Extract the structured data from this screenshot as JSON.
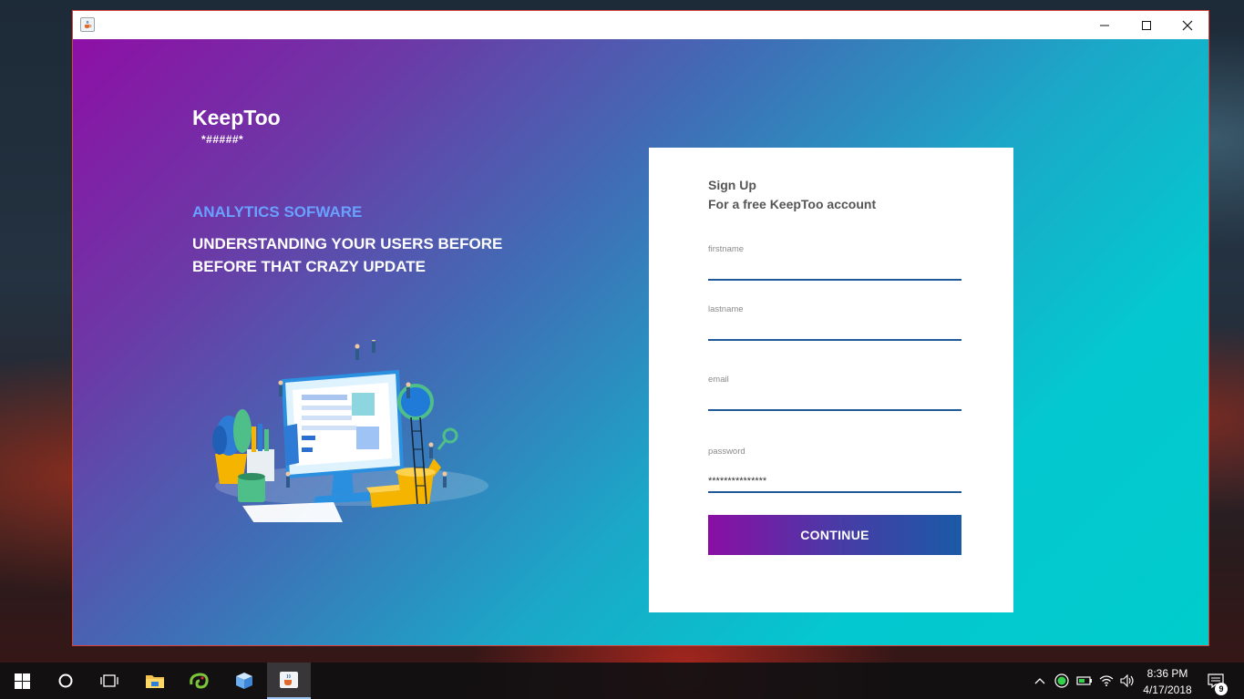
{
  "window": {
    "icon": "java-cup-icon",
    "controls": [
      "minimize-icon",
      "maximize-icon",
      "close-icon"
    ]
  },
  "hero": {
    "brand": "KeepToo",
    "brand_sub": "*#####*",
    "tagline_primary": "ANALYTICS SOFWARE",
    "tagline_secondary": "UNDERSTANDING YOUR USERS BEFORE BEFORE THAT CRAZY UPDATE"
  },
  "signup": {
    "title": "Sign Up",
    "subtitle": "For a free KeepToo account",
    "fields": [
      {
        "label": "firstname",
        "value": ""
      },
      {
        "label": "lastname",
        "value": ""
      },
      {
        "label": "email",
        "value": ""
      },
      {
        "label": "password",
        "value": "***************"
      }
    ],
    "continue_label": "CONTINUE"
  },
  "taskbar": {
    "apps": [
      "windows-start-icon",
      "cortana-icon",
      "task-view-icon",
      "file-explorer-icon",
      "chameleon-app-icon",
      "cube-app-icon",
      "java-app-icon"
    ],
    "time": "8:36 PM",
    "date": "4/17/2018",
    "notification_count": "9"
  },
  "colors": {
    "gradient_start": "#8e0fa6",
    "gradient_end": "#00cccc",
    "accent": "#6aa0ff",
    "input_underline": "#1e5a9a"
  }
}
